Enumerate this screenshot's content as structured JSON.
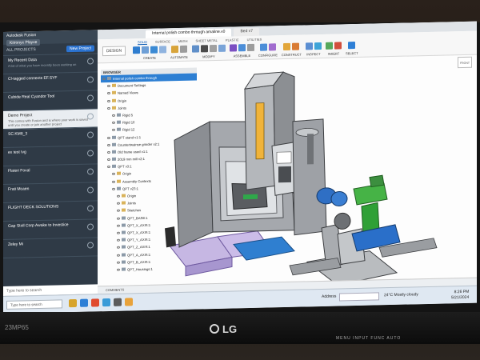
{
  "monitor": {
    "brand": "LG",
    "model": "23MP65",
    "keys": "MENU  INPUT  FUNC  AUTO"
  },
  "sidebar": {
    "app_name": "Autodesk Fusion",
    "hub_name": "Kitronyx Playve",
    "section_label": "ALL PROJECTS",
    "new_button": "New Project",
    "projects": [
      {
        "name": "My Recent Data",
        "desc": "A list of what you have recently been working on",
        "active": false
      },
      {
        "name": "Cl-tagged connects EF.SYF",
        "desc": "",
        "active": false
      },
      {
        "name": "Cubide Real Cyandor Tool",
        "desc": "",
        "active": false
      },
      {
        "name": "Demo Project",
        "desc": "This comes with Fusion and is where your work is saved until you create or join another project",
        "active": true
      },
      {
        "name": "SC.KM8_3",
        "desc": "",
        "active": false
      },
      {
        "name": "ex test Ivg",
        "desc": "",
        "active": false
      },
      {
        "name": "Flateri Foval",
        "desc": "",
        "active": false
      },
      {
        "name": "Frati Mcaen",
        "desc": "",
        "active": false
      },
      {
        "name": "FLIGHT DECK SOLUTIONS",
        "desc": "",
        "active": false
      },
      {
        "name": "Gap Stoll Corp Awake to Investice",
        "desc": "",
        "active": false
      },
      {
        "name": "Zeley Mi",
        "desc": "",
        "active": false
      }
    ],
    "search_placeholder": "Type here to search"
  },
  "tabs": [
    {
      "label": "Internal polish combo through amaline.v0",
      "active": true
    },
    {
      "label": "Bed v7",
      "active": false
    }
  ],
  "toolbar": {
    "workspace": "DESIGN",
    "ribbon_tabs": [
      "SOLID",
      "SURFACE",
      "MESH",
      "SHEET METAL",
      "PLASTIC",
      "UTILITIES"
    ],
    "selected_tab": "SOLID",
    "groups": [
      {
        "label": "CREATE",
        "icons": [
          "#2f7dcf",
          "#6e9fd6",
          "#3b8ad4",
          "#8fb3df"
        ]
      },
      {
        "label": "AUTOMATE",
        "icons": [
          "#d8a43a",
          "#9c9c9c"
        ]
      },
      {
        "label": "MODIFY",
        "icons": [
          "#5f8fc9",
          "#4b4b4b",
          "#a0a0a0",
          "#7aa4d8"
        ]
      },
      {
        "label": "ASSEMBLE",
        "icons": [
          "#7b4fc2",
          "#4c8ed8",
          "#9c9c9c"
        ]
      },
      {
        "label": "CONFIGURE",
        "icons": [
          "#4c8ed8",
          "#a16ccf"
        ]
      },
      {
        "label": "CONSTRUCT",
        "icons": [
          "#e2a63a",
          "#d97b33"
        ]
      },
      {
        "label": "INSPECT",
        "icons": [
          "#5b8ed2",
          "#3ea4d8"
        ]
      },
      {
        "label": "INSERT",
        "icons": [
          "#56a85c",
          "#d24f3d"
        ]
      },
      {
        "label": "SELECT",
        "icons": [
          "#2e7fd6"
        ]
      }
    ]
  },
  "browser": {
    "header": "BROWSER",
    "nodes": [
      {
        "label": "Internal polish combo through",
        "kind": "cmp",
        "depth": 0,
        "selected": true
      },
      {
        "label": "Document Settings",
        "kind": "fld",
        "depth": 1,
        "selected": false
      },
      {
        "label": "Named Views",
        "kind": "fld",
        "depth": 1,
        "selected": false
      },
      {
        "label": "Origin",
        "kind": "fld",
        "depth": 1,
        "selected": false
      },
      {
        "label": "Joints",
        "kind": "fld",
        "depth": 1,
        "selected": false
      },
      {
        "label": "Rigid 5",
        "kind": "cmp",
        "depth": 2,
        "selected": false
      },
      {
        "label": "Rigid 10",
        "kind": "cmp",
        "depth": 2,
        "selected": false
      },
      {
        "label": "Rigid 12",
        "kind": "cmp",
        "depth": 2,
        "selected": false
      },
      {
        "label": "QPT stand v1:1",
        "kind": "cmp",
        "depth": 1,
        "selected": false
      },
      {
        "label": "Countertwainse grinder v2:1",
        "kind": "cmp",
        "depth": 1,
        "selected": false
      },
      {
        "label": "Old frame used v1:1",
        "kind": "cmp",
        "depth": 1,
        "selected": false
      },
      {
        "label": "2019 mm mill v2:1",
        "kind": "cmp",
        "depth": 1,
        "selected": false
      },
      {
        "label": "QPT v3:1",
        "kind": "cmp",
        "depth": 1,
        "selected": false
      },
      {
        "label": "Origin",
        "kind": "fld",
        "depth": 2,
        "selected": false
      },
      {
        "label": "Assembly Contexts",
        "kind": "fld",
        "depth": 2,
        "selected": false
      },
      {
        "label": "QPT v23:1",
        "kind": "cmp",
        "depth": 2,
        "selected": false
      },
      {
        "label": "Origin",
        "kind": "fld",
        "depth": 3,
        "selected": false
      },
      {
        "label": "Joints",
        "kind": "fld",
        "depth": 3,
        "selected": false
      },
      {
        "label": "Sketches",
        "kind": "fld",
        "depth": 3,
        "selected": false
      },
      {
        "label": "QPT_BASE:1",
        "kind": "cmp",
        "depth": 3,
        "selected": false
      },
      {
        "label": "QPT_X_AXIS:1",
        "kind": "cmp",
        "depth": 3,
        "selected": false
      },
      {
        "label": "QPT_X_AXIS:1",
        "kind": "cmp",
        "depth": 3,
        "selected": false
      },
      {
        "label": "QPT_Y_AXIS:1",
        "kind": "cmp",
        "depth": 3,
        "selected": false
      },
      {
        "label": "QPT_Z_AXIS:1",
        "kind": "cmp",
        "depth": 3,
        "selected": false
      },
      {
        "label": "QPT_A_AXIS:1",
        "kind": "cmp",
        "depth": 3,
        "selected": false
      },
      {
        "label": "QPT_B_AXIS:1",
        "kind": "cmp",
        "depth": 3,
        "selected": false
      },
      {
        "label": "QPT_Housings:1",
        "kind": "cmp",
        "depth": 3,
        "selected": false
      }
    ]
  },
  "viewcube": "FRONT",
  "comments_label": "COMMENTS",
  "taskbar": {
    "search": "Type here to search",
    "address_label": "Address",
    "weather": "24°C  Mostly cloudy",
    "time": "8:26 PM",
    "date": "5/21/2024"
  }
}
